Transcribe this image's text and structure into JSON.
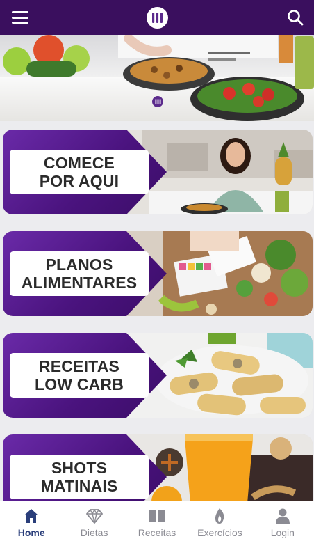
{
  "colors": {
    "topbar": "#3a0f5e",
    "tag_purple": "#4a137e",
    "nav_active": "#2a3e7a",
    "nav_inactive": "#8b8b93"
  },
  "header": {
    "menu_icon": "hamburger-menu-icon",
    "logo_icon": "brand-logo-icon",
    "search_icon": "search-icon"
  },
  "cards": [
    {
      "label": "COMECE\nPOR AQUI"
    },
    {
      "label": "PLANOS\nALIMENTARES"
    },
    {
      "label": "RECEITAS\nLOW CARB"
    },
    {
      "label": "SHOTS\nMATINAIS"
    }
  ],
  "bottom_nav": {
    "active": "Home",
    "items": [
      {
        "label": "Home",
        "icon": "home-icon"
      },
      {
        "label": "Dietas",
        "icon": "diamond-icon"
      },
      {
        "label": "Receitas",
        "icon": "book-icon"
      },
      {
        "label": "Exercícios",
        "icon": "flame-icon"
      },
      {
        "label": "Login",
        "icon": "user-icon"
      }
    ]
  }
}
